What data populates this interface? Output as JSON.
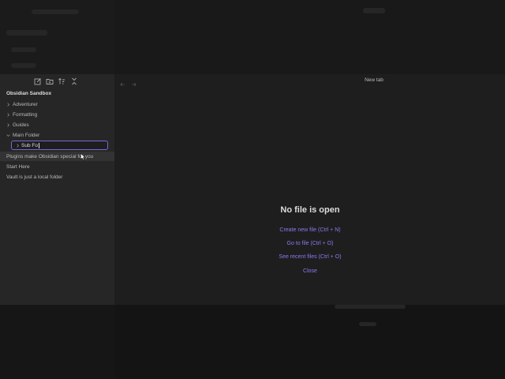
{
  "ghost": {
    "top_header": "New tab"
  },
  "sidebar": {
    "vault_name": "Obsidian Sandbox",
    "toolbar": {
      "new_note_icon": "pencil-square-icon",
      "new_folder_icon": "folder-plus-icon",
      "sort_icon": "sort-icon",
      "collapse_icon": "collapse-icon"
    },
    "folders": [
      {
        "label": "Adventurer",
        "expanded": false
      },
      {
        "label": "Formatting",
        "expanded": false
      },
      {
        "label": "Guides",
        "expanded": false
      },
      {
        "label": "Main Folder",
        "expanded": true
      }
    ],
    "rename_input": {
      "value": "Sub Fo"
    },
    "files": [
      {
        "label": "Plugins make Obsidian special for you"
      },
      {
        "label": "Start Here"
      },
      {
        "label": "Vault is just a local folder"
      }
    ]
  },
  "main": {
    "tab_title": "New tab",
    "empty_state": {
      "title": "No file is open",
      "actions": [
        "Create new file (Ctrl + N)",
        "Go to file (Ctrl + O)",
        "See recent files (Ctrl + O)",
        "Close"
      ]
    }
  },
  "colors": {
    "accent": "#8a7bf0",
    "input_border": "#7a67d9",
    "sidebar_bg": "#262626",
    "main_bg": "#1e1e1e"
  }
}
